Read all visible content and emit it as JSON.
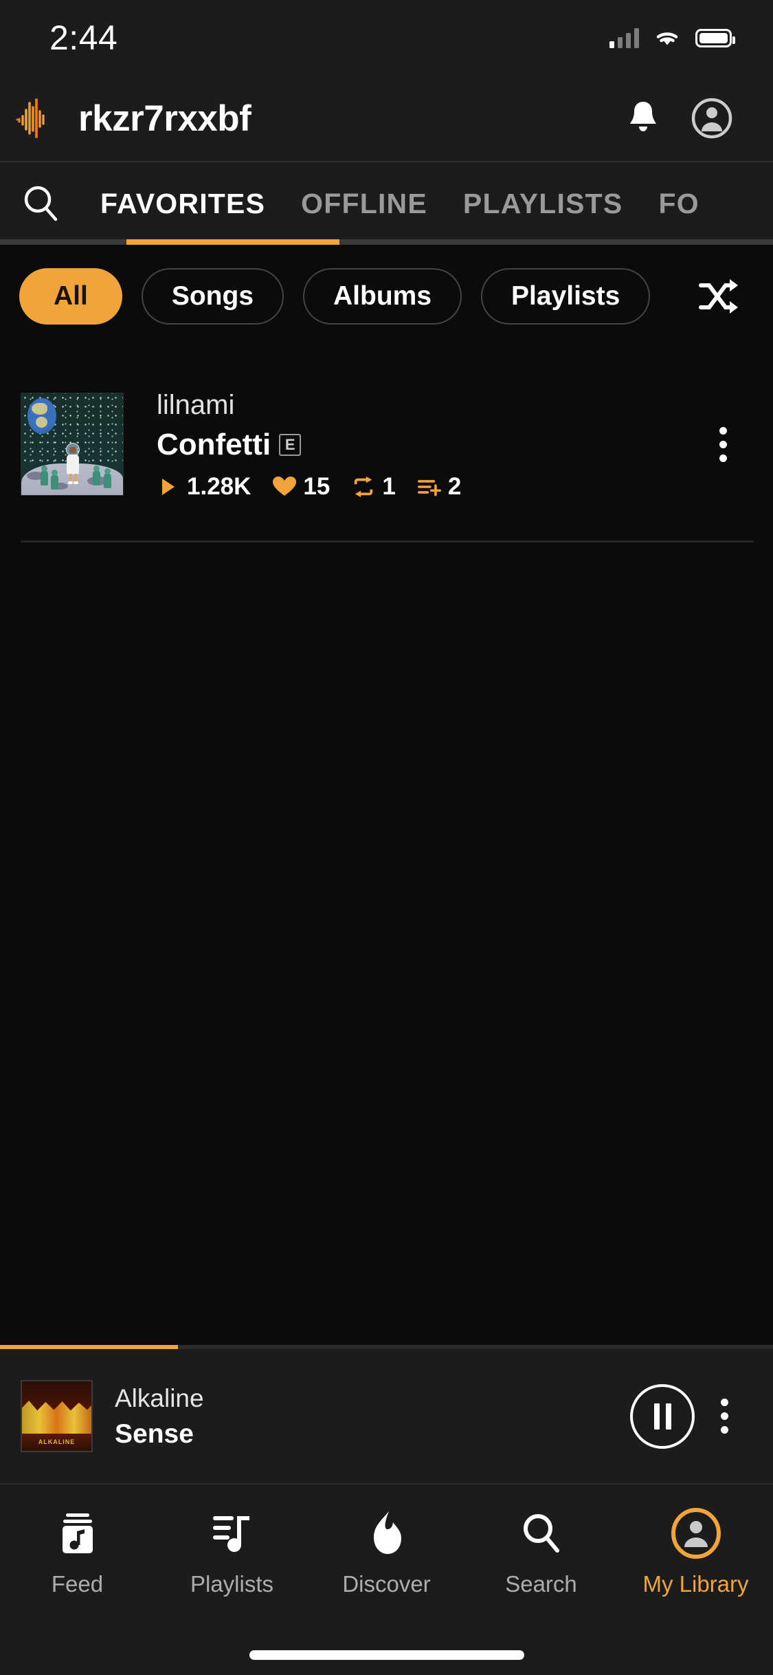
{
  "theme": {
    "accent": "#f0a43a",
    "bg": "#0b0b0b",
    "surface": "#1c1c1c",
    "text": "#ffffff",
    "muted": "#9a9a9a"
  },
  "status_bar": {
    "time": "2:44",
    "cellular_icon": "signal-bars-icon",
    "wifi_icon": "wifi-icon",
    "battery_icon": "battery-full-icon"
  },
  "header": {
    "logo_icon": "audiomack-waveform-logo",
    "brand": "rkzr7rxxbf",
    "notifications_icon": "bell-icon",
    "account_icon": "account-circle-icon"
  },
  "tab_strip": {
    "search_icon": "search-icon",
    "tabs": [
      {
        "label": "FAVORITES",
        "active": true
      },
      {
        "label": "OFFLINE",
        "active": false
      },
      {
        "label": "PLAYLISTS",
        "active": false
      },
      {
        "label": "FO",
        "active": false
      }
    ]
  },
  "filters": {
    "chips": [
      {
        "label": "All",
        "active": true
      },
      {
        "label": "Songs",
        "active": false
      },
      {
        "label": "Albums",
        "active": false
      },
      {
        "label": "Playlists",
        "active": false
      }
    ],
    "shuffle_icon": "shuffle-icon"
  },
  "tracks": [
    {
      "artwork_name": "album-art-confetti",
      "artist": "lilnami",
      "title": "Confetti",
      "explicit_badge": "E",
      "stats": [
        {
          "icon": "play-icon",
          "value": "1.28K"
        },
        {
          "icon": "heart-icon",
          "value": "15"
        },
        {
          "icon": "repost-icon",
          "value": "1"
        },
        {
          "icon": "add-to-playlist-icon",
          "value": "2"
        }
      ],
      "more_icon": "more-vertical-icon"
    }
  ],
  "mini_player": {
    "artwork_name": "album-art-sense",
    "artwork_caption": "ALKALINE",
    "artist": "Alkaline",
    "title": "Sense",
    "progress_percent": 23,
    "pause_icon": "pause-icon",
    "more_icon": "more-vertical-icon"
  },
  "bottom_nav": {
    "items": [
      {
        "label": "Feed",
        "icon": "feed-music-icon",
        "active": false
      },
      {
        "label": "Playlists",
        "icon": "playlist-music-icon",
        "active": false
      },
      {
        "label": "Discover",
        "icon": "flame-icon",
        "active": false
      },
      {
        "label": "Search",
        "icon": "search-icon",
        "active": false
      },
      {
        "label": "My Library",
        "icon": "account-circle-icon",
        "active": true
      }
    ]
  },
  "home_indicator": "home-indicator"
}
